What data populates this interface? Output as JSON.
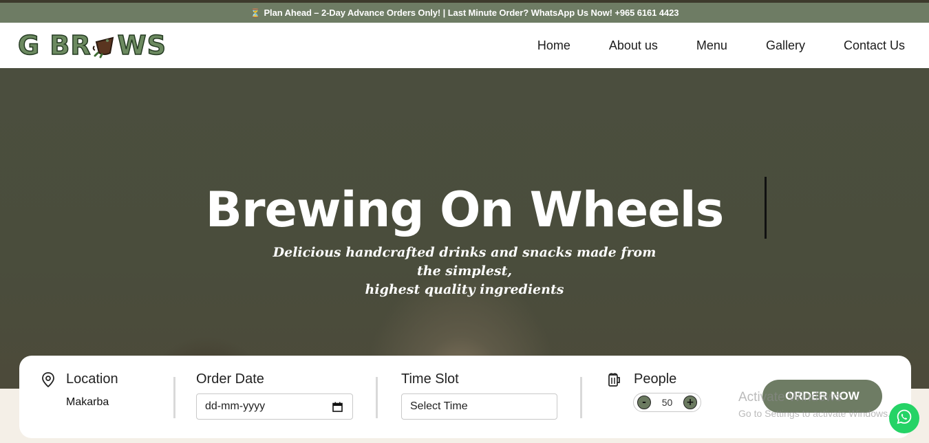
{
  "announcement": {
    "icon": "hourglass-icon",
    "text": "Plan Ahead – 2-Day Advance Orders Only! | Last Minute Order? WhatsApp Us Now! +965 6161 4423"
  },
  "header": {
    "logo": {
      "left": "G BR",
      "right": "WS"
    },
    "nav": [
      "Home",
      "About us",
      "Menu",
      "Gallery",
      "Contact Us"
    ]
  },
  "hero": {
    "title": "Brewing On Wheels",
    "subtitle_line1": "Delicious handcrafted drinks and snacks made from the simplest,",
    "subtitle_line2": "highest quality ingredients"
  },
  "booking": {
    "location": {
      "icon": "location-pin-icon",
      "label": "Location",
      "value": "Makarba"
    },
    "order_date": {
      "label": "Order Date",
      "placeholder": "dd-mm-yyyy",
      "icon": "calendar-icon"
    },
    "time_slot": {
      "label": "Time Slot",
      "selected": "Select Time"
    },
    "people": {
      "icon": "beer-mug-icon",
      "label": "People",
      "minus": "-",
      "plus": "+",
      "count": "50"
    },
    "order_button": "ORDER NOW"
  },
  "watermark": {
    "line1": "Activate Windows",
    "line2": "Go to Settings to activate Windows."
  },
  "whatsapp": {
    "icon": "whatsapp-icon"
  },
  "colors": {
    "brand_green": "#6e7c64",
    "whatsapp": "#25d366"
  }
}
